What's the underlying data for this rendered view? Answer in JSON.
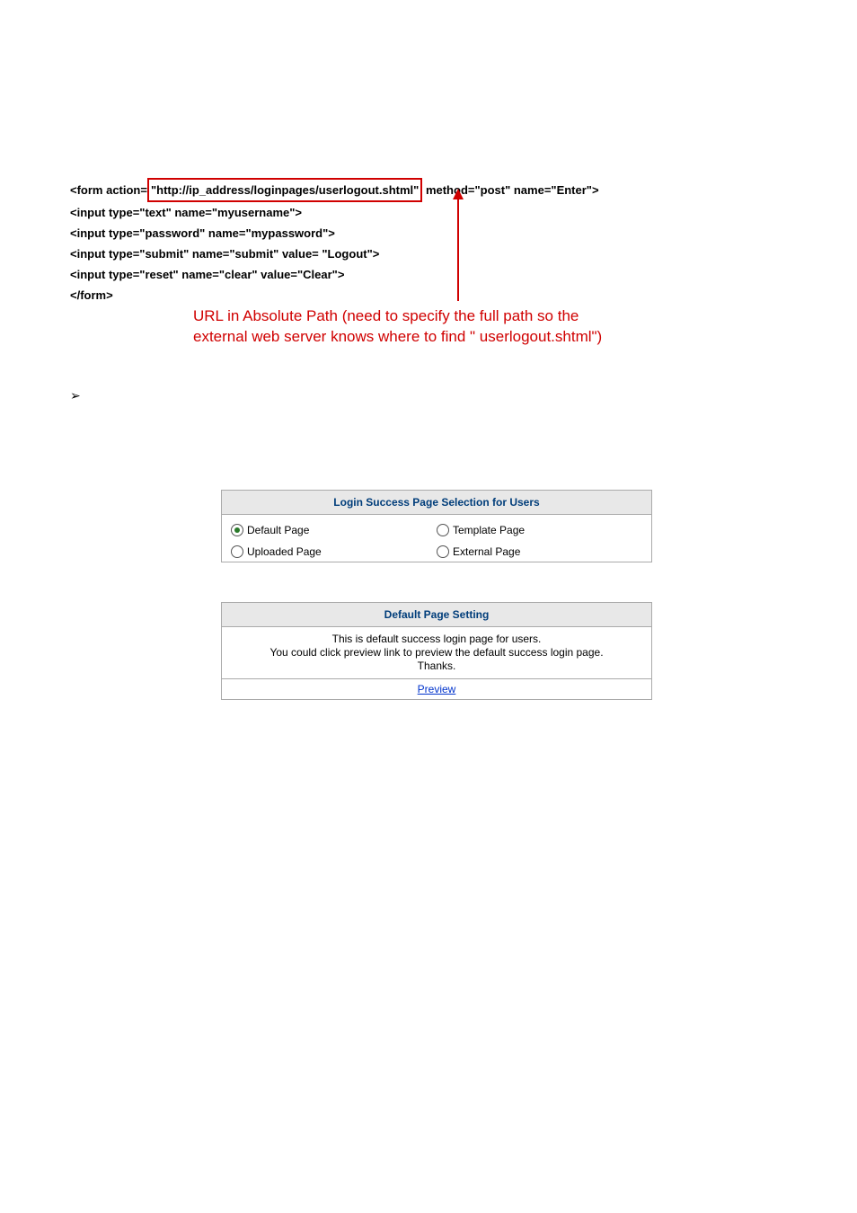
{
  "code": {
    "line1_pre": "<form action=",
    "line1_boxed": "\"http://ip_address/loginpages/userlogout.shtml\"",
    "line1_post": " method=\"post\" name=\"Enter\">",
    "line2": "<input type=\"text\" name=\"myusername\">",
    "line3": "<input type=\"password\" name=\"mypassword\">",
    "line4": "<input type=\"submit\" name=\"submit\" value= \"Logout\">",
    "line5": "<input type=\"reset\" name=\"clear\" value=\"Clear\">",
    "line6": "</form>"
  },
  "annotation": {
    "line1": "URL in Absolute Path (need to specify the full path so the",
    "line2": "external web server knows where to find \" userlogout.shtml\")"
  },
  "bullet": "➢",
  "panel1": {
    "header": "Login Success Page Selection for Users",
    "options": {
      "default_page": "Default Page",
      "template_page": "Template Page",
      "uploaded_page": "Uploaded Page",
      "external_page": "External Page"
    }
  },
  "panel2": {
    "header": "Default Page Setting",
    "body_line1": "This is default success login page for users.",
    "body_line2": "You could click preview link to preview the default success login page.",
    "body_line3": "Thanks.",
    "preview": "Preview"
  }
}
